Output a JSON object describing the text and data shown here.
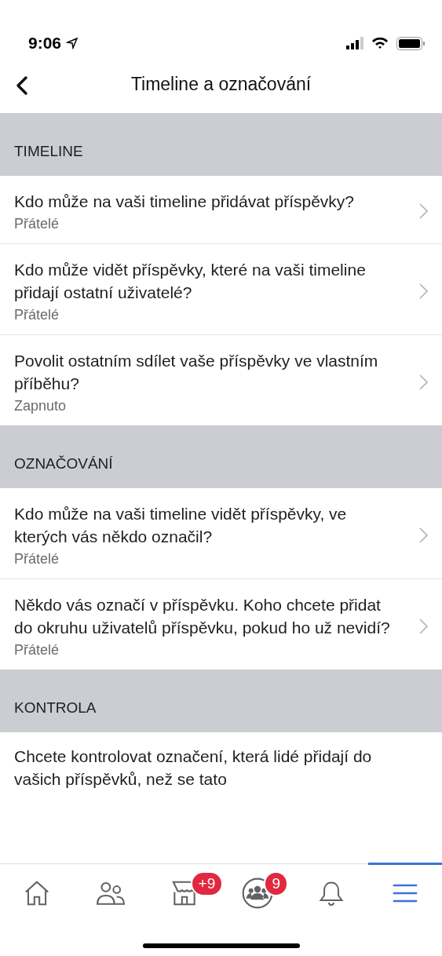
{
  "status_bar": {
    "time": "9:06"
  },
  "header": {
    "title": "Timeline a označování"
  },
  "sections": [
    {
      "title": "TIMELINE",
      "items": [
        {
          "title": "Kdo může na vaši timeline přidávat příspěvky?",
          "value": "Přátelé"
        },
        {
          "title": "Kdo může vidět příspěvky, které na vaši timeline přidají ostatní uživatelé?",
          "value": "Přátelé"
        },
        {
          "title": "Povolit ostatním sdílet vaše příspěvky ve vlastním příběhu?",
          "value": "Zapnuto"
        }
      ]
    },
    {
      "title": "OZNAČOVÁNÍ",
      "items": [
        {
          "title": "Kdo může na vaši timeline vidět příspěvky, ve kterých vás někdo označil?",
          "value": "Přátelé"
        },
        {
          "title": "Někdo vás označí v příspěvku. Koho chcete přidat do okruhu uživatelů příspěvku, pokud ho už nevidí?",
          "value": "Přátelé"
        }
      ]
    },
    {
      "title": "KONTROLA",
      "items": [
        {
          "title": "Chcete kontrolovat označení, která lidé přidají do vašich příspěvků, než se tato"
        }
      ]
    }
  ],
  "tab_bar": [
    {
      "kind": "home",
      "selected": false
    },
    {
      "kind": "friends",
      "selected": false
    },
    {
      "kind": "marketplace",
      "selected": false,
      "badge": "+9"
    },
    {
      "kind": "groups",
      "selected": false,
      "badge": "9"
    },
    {
      "kind": "notifications",
      "selected": false
    },
    {
      "kind": "menu",
      "selected": true
    }
  ]
}
